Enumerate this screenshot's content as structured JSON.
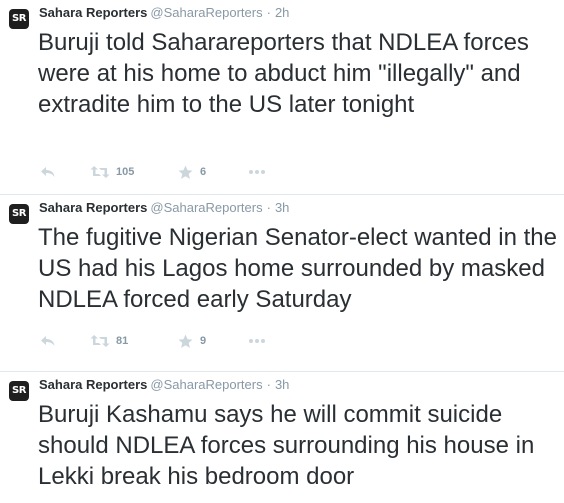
{
  "account": {
    "avatar_text": "SR",
    "name": "Sahara Reporters",
    "handle": "@SaharaReporters",
    "separator": "·"
  },
  "tweets": [
    {
      "time": "2h",
      "text": "Buruji told Saharareporters that NDLEA forces were at his home to abduct him \"illegally\" and extradite him to the US later tonight",
      "retweets": "105",
      "favorites": "6"
    },
    {
      "time": "3h",
      "text": "The fugitive Nigerian Senator-elect wanted in the US had his Lagos home surrounded by masked NDLEA forced early Saturday",
      "retweets": "81",
      "favorites": "9"
    },
    {
      "time": "3h",
      "text": "Buruji Kashamu says he will commit suicide should NDLEA forces surrounding his house in Lekki break his bedroom door"
    }
  ],
  "icons": {
    "reply": "reply-icon",
    "retweet": "retweet-icon",
    "favorite": "star-icon",
    "more": "more-dots-icon"
  },
  "colors": {
    "text": "#292f33",
    "muted": "#8899a6",
    "avatar_bg": "#1f1f1f",
    "divider": "#e1e8ed"
  }
}
